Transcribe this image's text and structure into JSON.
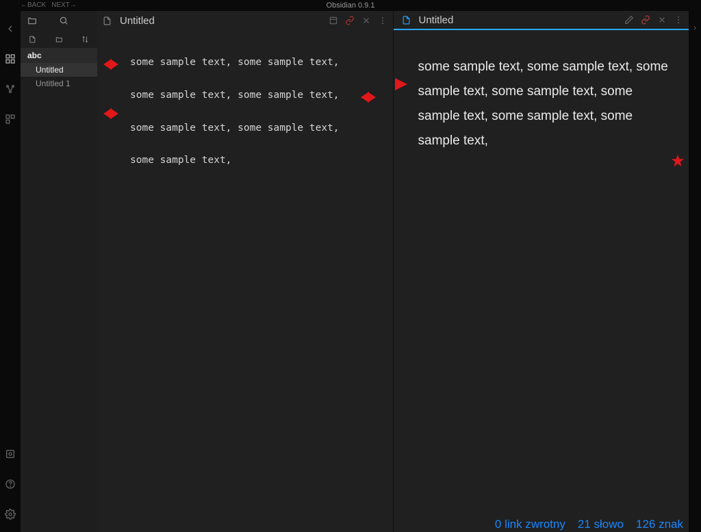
{
  "app": {
    "title": "Obsidian 0.9.1"
  },
  "nav": {
    "back": "←BACK",
    "next": "NEXT→"
  },
  "sidebar": {
    "vault": "abc",
    "files": [
      {
        "name": "Untitled",
        "active": true
      },
      {
        "name": "Untitled 1",
        "active": false
      }
    ]
  },
  "panes": {
    "editor": {
      "title": "Untitled",
      "lines": [
        "some sample text, some sample text,",
        "some sample text, some sample text,",
        "some sample text, some sample text,",
        "some sample text,"
      ]
    },
    "preview": {
      "title": "Untitled",
      "body": "some sample text, some sample text, some sample text, some sample text, some sample text, some sample text, some sample text,"
    }
  },
  "status": {
    "backlinks": "0 link zwrotny",
    "words": "21 słowo",
    "chars": "126 znak"
  }
}
